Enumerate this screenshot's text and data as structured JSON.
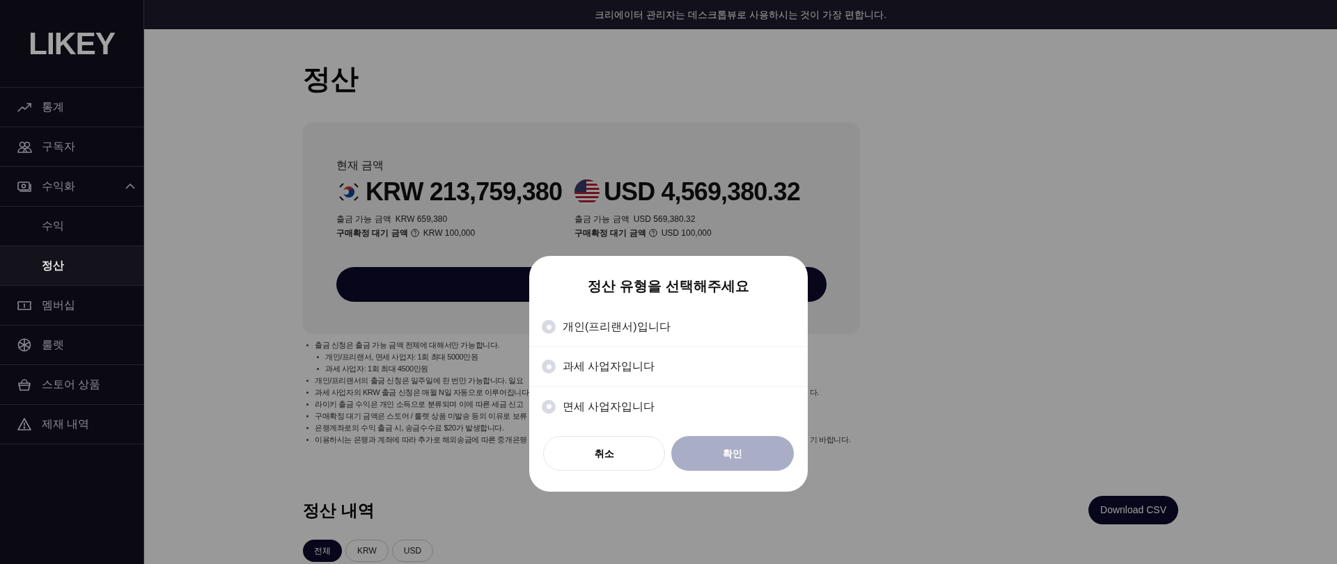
{
  "banner": {
    "text": "크리에이터 관리자는 데스크톱뷰로 사용하시는 것이 가장 편합니다."
  },
  "sidebar": {
    "logo": "LIKEY",
    "items": [
      {
        "label": "통계",
        "selected": false
      },
      {
        "label": "구독자",
        "selected": false
      },
      {
        "label": "수익화",
        "selected": false,
        "expanded": true,
        "children": [
          {
            "label": "수익",
            "selected": false
          },
          {
            "label": "정산",
            "selected": true
          }
        ]
      },
      {
        "label": "멤버십",
        "selected": false
      },
      {
        "label": "룰렛",
        "selected": false
      },
      {
        "label": "스토어 상품",
        "selected": false
      },
      {
        "label": "제재 내역",
        "selected": false
      }
    ]
  },
  "page_title": "정산",
  "balance": {
    "label": "현재 금액",
    "accounts": [
      {
        "amount": "KRW 213,759,380",
        "available_label": "출금 가능 금액",
        "available": "KRW 659,380",
        "pending_label": "구매확정 대기 금액",
        "pending": "KRW 100,000"
      },
      {
        "amount": "USD 4,569,380.32",
        "available_label": "출금 가능 금액",
        "available": "USD 569,380.32",
        "pending_label": "구매확정 대기 금액",
        "pending": "USD 100,000"
      }
    ]
  },
  "notes": [
    {
      "text": "출금 신청은 출금 가능 금액 전체에 대해서만 가능합니다.",
      "children": [
        {
          "text": "개인/프리랜서, 면세 사업자: 1회 최대 5000만원"
        },
        {
          "text": "과세 사업자: 1회 최대 4500만원"
        }
      ]
    },
    {
      "text": "개인/프리랜서의 출금 신청은 일주일에 한 번만 가능합니다. 일요"
    },
    {
      "text": "과세 사업자의 KRW 출금 신청은 매월 N일 자동으로 이루어집니다",
      "tail": "다."
    },
    {
      "text": "라이키 출금 수익은 개인 소득으로 분류되며 이에 따른 세금 신고"
    },
    {
      "text": "구매확정 대기 금액은 스토어 / 룰렛 상품 미발송 등의 이유로 보류"
    },
    {
      "text": "은행계좌로의 수익 출금 시, 송금수수료 $20가 발생합니다."
    },
    {
      "text": "이용하시는 은행과 계좌에 따라 추가로 해외송금에 따른 중개은행",
      "tail": "기 바랍니다."
    }
  ],
  "history": {
    "title": "정산 내역",
    "download": "Download CSV",
    "tabs": [
      {
        "label": "전체",
        "selected": true
      },
      {
        "label": "KRW",
        "selected": false
      },
      {
        "label": "USD",
        "selected": false
      }
    ]
  },
  "modal": {
    "title": "정산 유형을 선택해주세요",
    "options": [
      {
        "label": "개인(프리랜서)입니다",
        "selected": false
      },
      {
        "label": "과세 사업자입니다",
        "selected": false
      },
      {
        "label": "면세 사업자입니다",
        "selected": false
      }
    ],
    "cancel": "취소",
    "confirm": {
      "label": "확인",
      "disabled": true
    }
  }
}
